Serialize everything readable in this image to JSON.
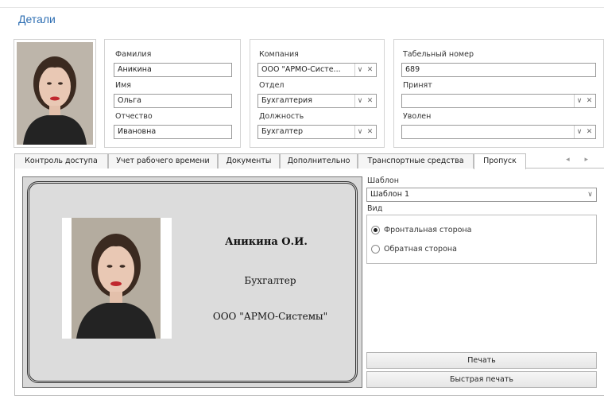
{
  "panel": {
    "title": "Детали"
  },
  "person": {
    "lastname_label": "Фамилия",
    "lastname_value": "Аникина",
    "firstname_label": "Имя",
    "firstname_value": "Ольга",
    "patronymic_label": "Отчество",
    "patronymic_value": "Ивановна"
  },
  "org": {
    "company_label": "Компания",
    "company_value": "ООО \"АРМО-Систе...",
    "department_label": "Отдел",
    "department_value": "Бухгалтерия",
    "position_label": "Должность",
    "position_value": "Бухгалтер"
  },
  "employment": {
    "tabnum_label": "Табельный номер",
    "tabnum_value": "689",
    "hired_label": "Принят",
    "hired_value": "",
    "fired_label": "Уволен",
    "fired_value": ""
  },
  "icons": {
    "dropdown": "chevron-down-icon",
    "clear": "close-icon",
    "tabs_left": "chevron-left-icon",
    "tabs_right": "chevron-right-icon"
  },
  "combo_glyphs": {
    "dropdown": "∨",
    "clear": "✕"
  },
  "tabs": [
    {
      "label": "Контроль доступа",
      "active": false
    },
    {
      "label": "Учет рабочего времени",
      "active": false
    },
    {
      "label": "Документы",
      "active": false
    },
    {
      "label": "Дополнительно",
      "active": false
    },
    {
      "label": "Транспортные средства",
      "active": false
    },
    {
      "label": "Пропуск",
      "active": true
    }
  ],
  "tab_arrows": "◂ ▸",
  "pass_card": {
    "name": "Аникина О.И.",
    "position": "Бухгалтер",
    "organization": "ООО \"АРМО-Системы\""
  },
  "pass_settings": {
    "template_label": "Шаблон",
    "template_value": "Шаблон 1",
    "view_label": "Вид",
    "view_options": [
      {
        "label": "Фронтальная сторона",
        "selected": true
      },
      {
        "label": "Обратная сторона",
        "selected": false
      }
    ],
    "print_label": "Печать",
    "quick_print_label": "Быстрая печать"
  },
  "colors": {
    "title_blue": "#2f6fb3",
    "card_bg": "#dcdcdc",
    "lipstick": "#c0282e"
  }
}
